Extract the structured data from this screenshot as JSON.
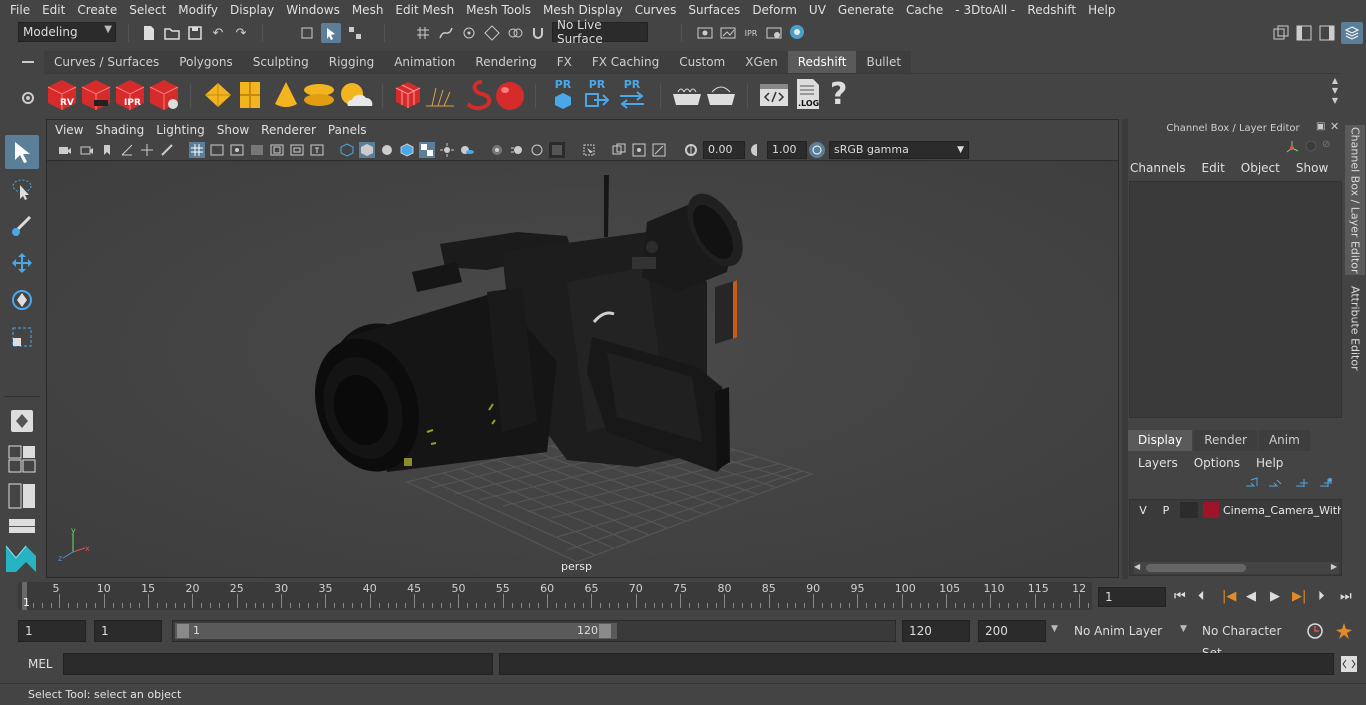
{
  "menubar": {
    "items": [
      "File",
      "Edit",
      "Create",
      "Select",
      "Modify",
      "Display",
      "Windows",
      "Mesh",
      "Edit Mesh",
      "Mesh Tools",
      "Mesh Display",
      "Curves",
      "Surfaces",
      "Deform",
      "UV",
      "Generate",
      "Cache",
      "- 3DtoAll -",
      "Redshift",
      "Help"
    ]
  },
  "statusline": {
    "mode": "Modeling",
    "live_surface": "No Live Surface"
  },
  "shelf": {
    "tabs": [
      "Curves / Surfaces",
      "Polygons",
      "Sculpting",
      "Rigging",
      "Animation",
      "Rendering",
      "FX",
      "FX Caching",
      "Custom",
      "XGen",
      "Redshift",
      "Bullet"
    ],
    "active_tab": "Redshift",
    "icon_labels": {
      "rv": "RV",
      "ipr": "IPR",
      "pr1": "PR",
      "pr2": "PR",
      "pr3": "PR",
      "log": ".LOG"
    }
  },
  "panel": {
    "menu": [
      "View",
      "Shading",
      "Lighting",
      "Show",
      "Renderer",
      "Panels"
    ],
    "exposure": "0.00",
    "gamma": "1.00",
    "colorspace": "sRGB gamma",
    "camera_label": "persp"
  },
  "channelbox": {
    "title": "Channel Box / Layer Editor",
    "menu": [
      "Channels",
      "Edit",
      "Object",
      "Show"
    ],
    "layer_tabs": [
      "Display",
      "Render",
      "Anim"
    ],
    "active_layer_tab": "Display",
    "layer_menu": [
      "Layers",
      "Options",
      "Help"
    ],
    "layer": {
      "v": "V",
      "p": "P",
      "color": "#a0142a",
      "name": "Cinema_Camera_With_"
    }
  },
  "side_tabs": [
    "Channel Box / Layer Editor",
    "Attribute Editor"
  ],
  "timeline": {
    "ticks": [
      "5",
      "10",
      "15",
      "20",
      "25",
      "30",
      "35",
      "40",
      "45",
      "50",
      "55",
      "60",
      "65",
      "70",
      "75",
      "80",
      "85",
      "90",
      "95",
      "100",
      "105",
      "110",
      "115",
      "12"
    ],
    "current_marker": "1",
    "current_frame": "1"
  },
  "range": {
    "start": "1",
    "playback_start": "1",
    "slider_start": "1",
    "slider_end": "120",
    "playback_end": "120",
    "end": "200",
    "anim_layer": "No Anim Layer",
    "character_set": "No Character Set"
  },
  "cmdline": {
    "label": "MEL"
  },
  "helpline": {
    "text": "Select Tool: select an object"
  },
  "colors": {
    "accent": "#5c7f99",
    "redshift_red": "#d62b2b",
    "bg": "#444444"
  }
}
